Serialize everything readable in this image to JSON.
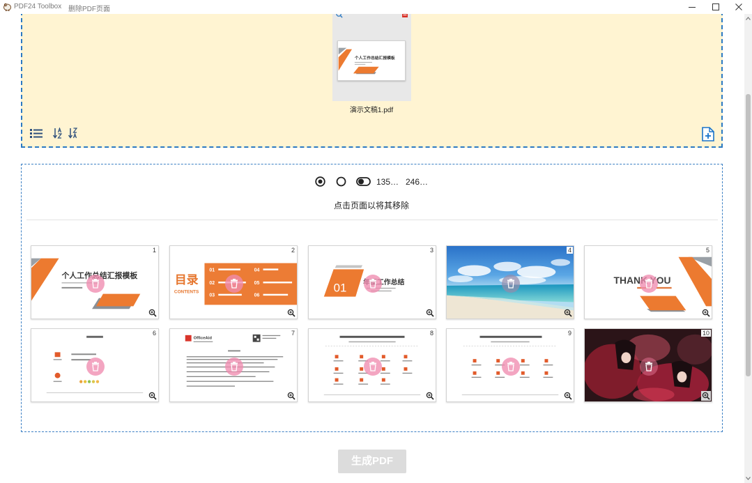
{
  "window": {
    "app_name": "PDF24 Toolbox",
    "tool_name": "删除PDF页面",
    "controls": [
      "minimize-icon",
      "maximize-icon",
      "close-icon"
    ]
  },
  "upload_area": {
    "file_name": "演示文稿1.pdf",
    "thumbnail_title": "个人工作总结汇报模板",
    "icons": [
      "zoom-icon",
      "pdf-file-icon",
      "list-view-icon",
      "sort-az-icon",
      "sort-za-icon",
      "add-file-icon"
    ]
  },
  "page_selector": {
    "modes": [
      {
        "icon": "radio-checked-icon",
        "selected": true
      },
      {
        "icon": "radio-unchecked-icon",
        "selected": false
      },
      {
        "icon": "toggle-icon",
        "selected": false
      }
    ],
    "odd_pages": "135…",
    "even_pages": "246…",
    "hint": "点击页面以将其移除"
  },
  "pages": [
    {
      "number": "1",
      "title": "个人工作总结汇报模板"
    },
    {
      "number": "2",
      "heading": "目录",
      "subheading": "CONTENTS",
      "items": [
        "01",
        "02",
        "03",
        "04",
        "05",
        "06"
      ]
    },
    {
      "number": "3",
      "section": "01",
      "title": "年度工作总结"
    },
    {
      "number": "4"
    },
    {
      "number": "5",
      "title": "THANK YOU"
    },
    {
      "number": "6"
    },
    {
      "number": "7",
      "logo_text": "OfficeAid"
    },
    {
      "number": "8"
    },
    {
      "number": "9"
    },
    {
      "number": "10"
    }
  ],
  "actions": {
    "generate_pdf": "生成PDF",
    "generate_enabled": false
  },
  "colors": {
    "accent_blue": "#2b79c2",
    "upload_bg": "#fff4d2",
    "slide_orange": "#ec7a30",
    "delete_overlay": "#f08cb0",
    "button_disabled": "#dcdcdc"
  }
}
